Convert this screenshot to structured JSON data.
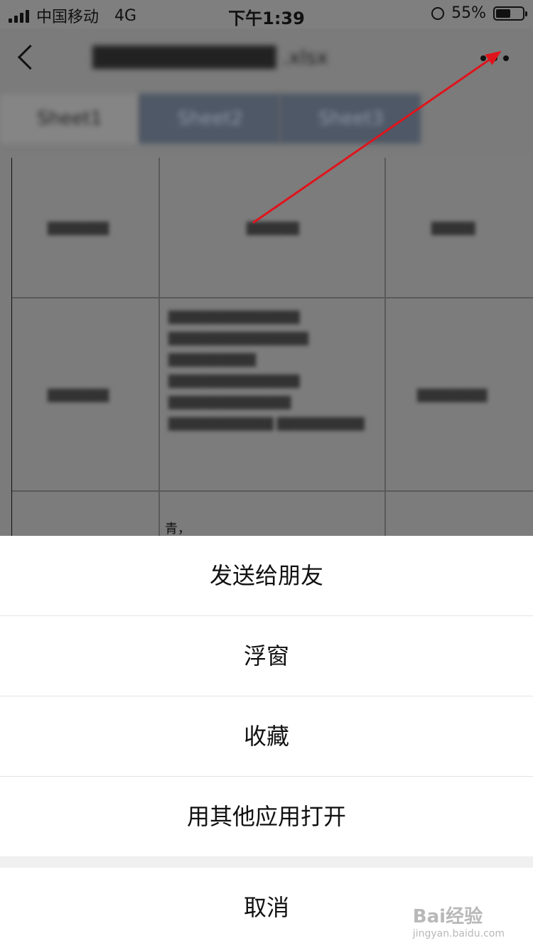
{
  "status_bar": {
    "carrier": "中国移动",
    "network": "4G",
    "time": "下午1:39",
    "battery": "55%",
    "battery_level": 0.55
  },
  "header": {
    "back_icon": "chevron-left-icon",
    "more_icon": "more-dots-icon",
    "tabs": [
      "Sheet1",
      "Sheet2",
      "Sheet3"
    ]
  },
  "document": {
    "visible_text": "青，"
  },
  "action_sheet": {
    "items": [
      "发送给朋友",
      "浮窗",
      "收藏",
      "用其他应用打开"
    ],
    "cancel": "取消"
  },
  "watermark": {
    "brand": "Bai经验",
    "url": "jingyan.baidu.com"
  },
  "colors": {
    "annotation_arrow": "#e0141c",
    "overlay": "#7b7b7b"
  }
}
